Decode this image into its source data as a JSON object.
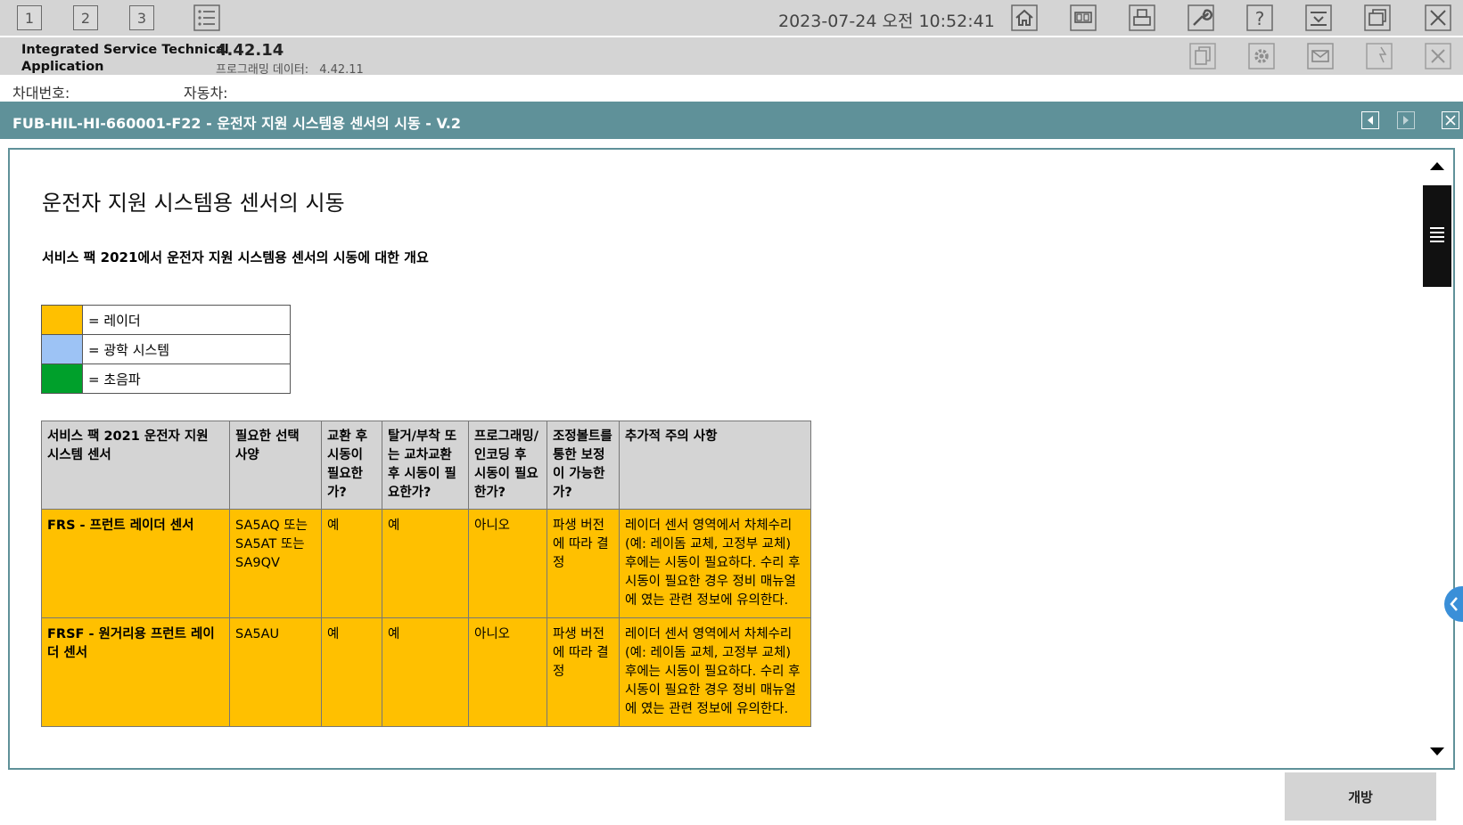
{
  "toolbar": {
    "workspaces": [
      "1",
      "2",
      "3"
    ],
    "datetime": "2023-07-24 오전 10:52:41"
  },
  "app": {
    "name_line1": "Integrated Service Technical",
    "name_line2": "Application",
    "version": "4.42.14",
    "programming_data_label": "프로그래밍 데이터:",
    "programming_data_value": "4.42.11"
  },
  "info": {
    "chassis_label": "차대번호:",
    "vehicle_label": "자동차:"
  },
  "document": {
    "title_bar": "FUB-HIL-HI-660001-F22 - 운전자 지원 시스템용 센서의 시동 - V.2",
    "heading": "운전자 지원 시스템용 센서의 시동",
    "subtitle": "서비스 팩 2021에서 운전자 지원 시스템용 센서의 시동에 대한 개요",
    "legend": [
      {
        "color": "#ffc000",
        "label": "= 레이더"
      },
      {
        "color": "#9dc3f5",
        "label": "= 광학 시스템"
      },
      {
        "color": "#00a02b",
        "label": "= 초음파"
      }
    ],
    "table": {
      "headers": [
        "서비스 팩 2021 운전자 지원 시스템 센서",
        "필요한 선택 사양",
        "교환 후 시동이 필요한가?",
        "탈거/부착 또는 교차교환 후 시동이 필요한가?",
        "프로그래밍/인코딩 후 시동이 필요한가?",
        "조정볼트를 통한 보정이 가능한가?",
        "추가적 주의 사항"
      ],
      "rows": [
        [
          "FRS - 프런트 레이더 센서",
          "SA5AQ 또는 SA5AT 또는 SA9QV",
          "예",
          "예",
          "아니오",
          "파생 버전에 따라 결정",
          "레이더 센서 영역에서 차체수리(예: 레이돔 교체, 고정부 교체) 후에는 시동이 필요하다. 수리 후 시동이 필요한 경우 정비 매뉴얼에 였는 관련 정보에 유의한다."
        ],
        [
          "FRSF - 원거리용 프런트 레이더 센서",
          "SA5AU",
          "예",
          "예",
          "아니오",
          "파생 버전에 따라 결정",
          "레이더 센서 영역에서 차체수리(예: 레이돔 교체, 고정부 교체) 후에는 시동이 필요하다. 수리 후 시동이 필요한 경우 정비 매뉴얼에 였는 관련 정보에 유의한다."
        ]
      ]
    }
  },
  "footer": {
    "open_button": "개방"
  },
  "colors": {
    "title_bar": "#5f9199",
    "radar_row": "#ffc000",
    "chrome": "#d4d4d4"
  }
}
